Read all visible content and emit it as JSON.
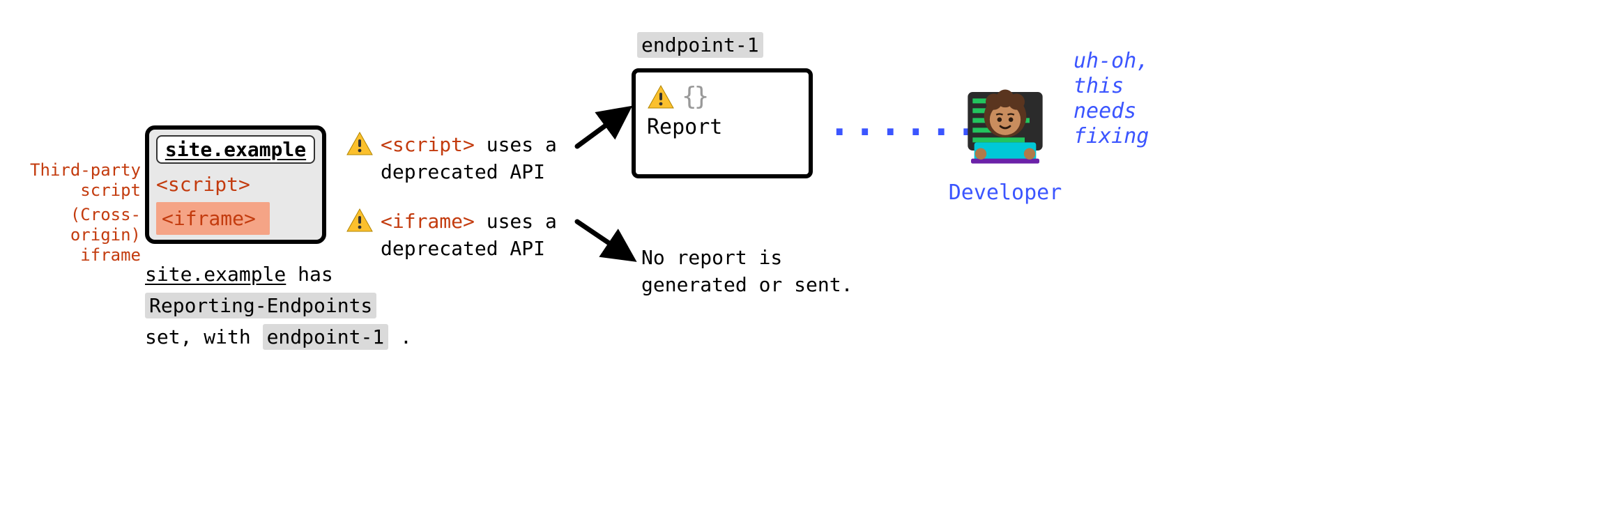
{
  "browser": {
    "url": "site.example",
    "script_tag": "<script>",
    "iframe_tag": "<iframe>"
  },
  "side_labels": {
    "third_party": "Third-party\nscript",
    "cross_origin": "(Cross-origin)\niframe"
  },
  "caption": {
    "line1_underlined": "site.example",
    "line1_rest": " has",
    "line2_hl": "Reporting-Endpoints",
    "line3_pre": "set, with ",
    "line3_hl": "endpoint-1",
    "line3_post": " ."
  },
  "warnings": {
    "script": {
      "code": "<script>",
      "rest": " uses a deprecated API"
    },
    "iframe": {
      "code": "<iframe>",
      "rest": " uses a deprecated API"
    }
  },
  "endpoint": {
    "title": "endpoint-1",
    "braces": "{}",
    "report": "Report"
  },
  "noreport": "No report is generated or sent.",
  "dots": "······",
  "developer": {
    "label": "Developer",
    "thought": "uh-oh,\nthis\nneeds\nfixing"
  }
}
